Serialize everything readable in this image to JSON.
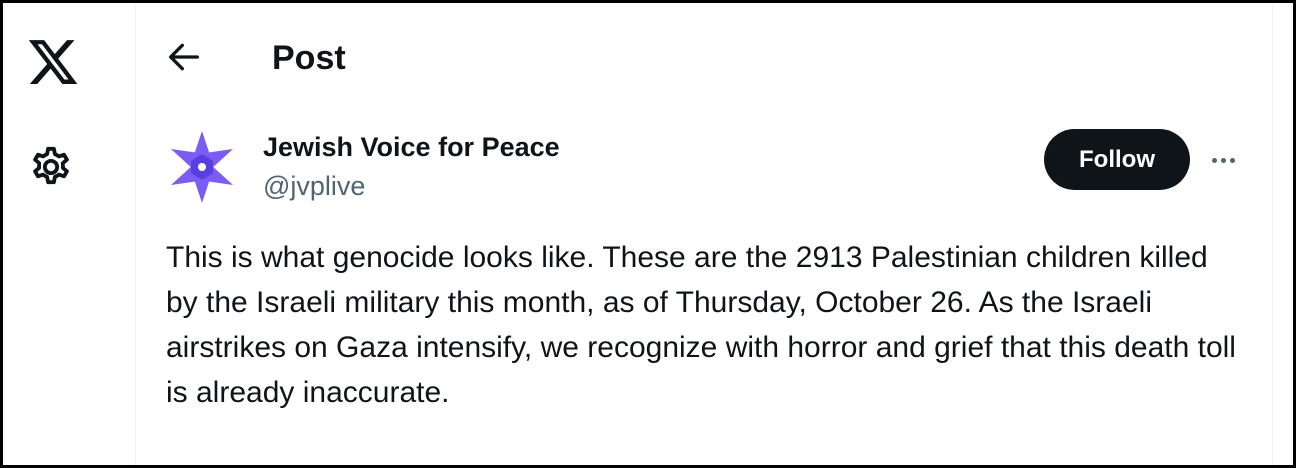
{
  "nav": {
    "icons": [
      "x-logo-icon",
      "settings-gear-icon"
    ]
  },
  "header": {
    "title": "Post",
    "back_icon": "arrow-left-icon"
  },
  "post": {
    "author": {
      "display_name": "Jewish Voice for Peace",
      "handle": "@jvplive",
      "avatar_color": "#7b5cf5"
    },
    "follow_label": "Follow",
    "more_icon": "more-horizontal-icon",
    "text": "This is what genocide looks like. These are the 2913 Palestinian children killed by the Israeli military this month, as of Thursday, October 26. As the Israeli airstrikes on Gaza intensify, we recognize with horror and grief that this death toll is already inaccurate."
  },
  "colors": {
    "text_primary": "#0f1419",
    "text_secondary": "#536471",
    "follow_bg": "#0f1419",
    "follow_text": "#ffffff",
    "frame_border": "#000000"
  }
}
